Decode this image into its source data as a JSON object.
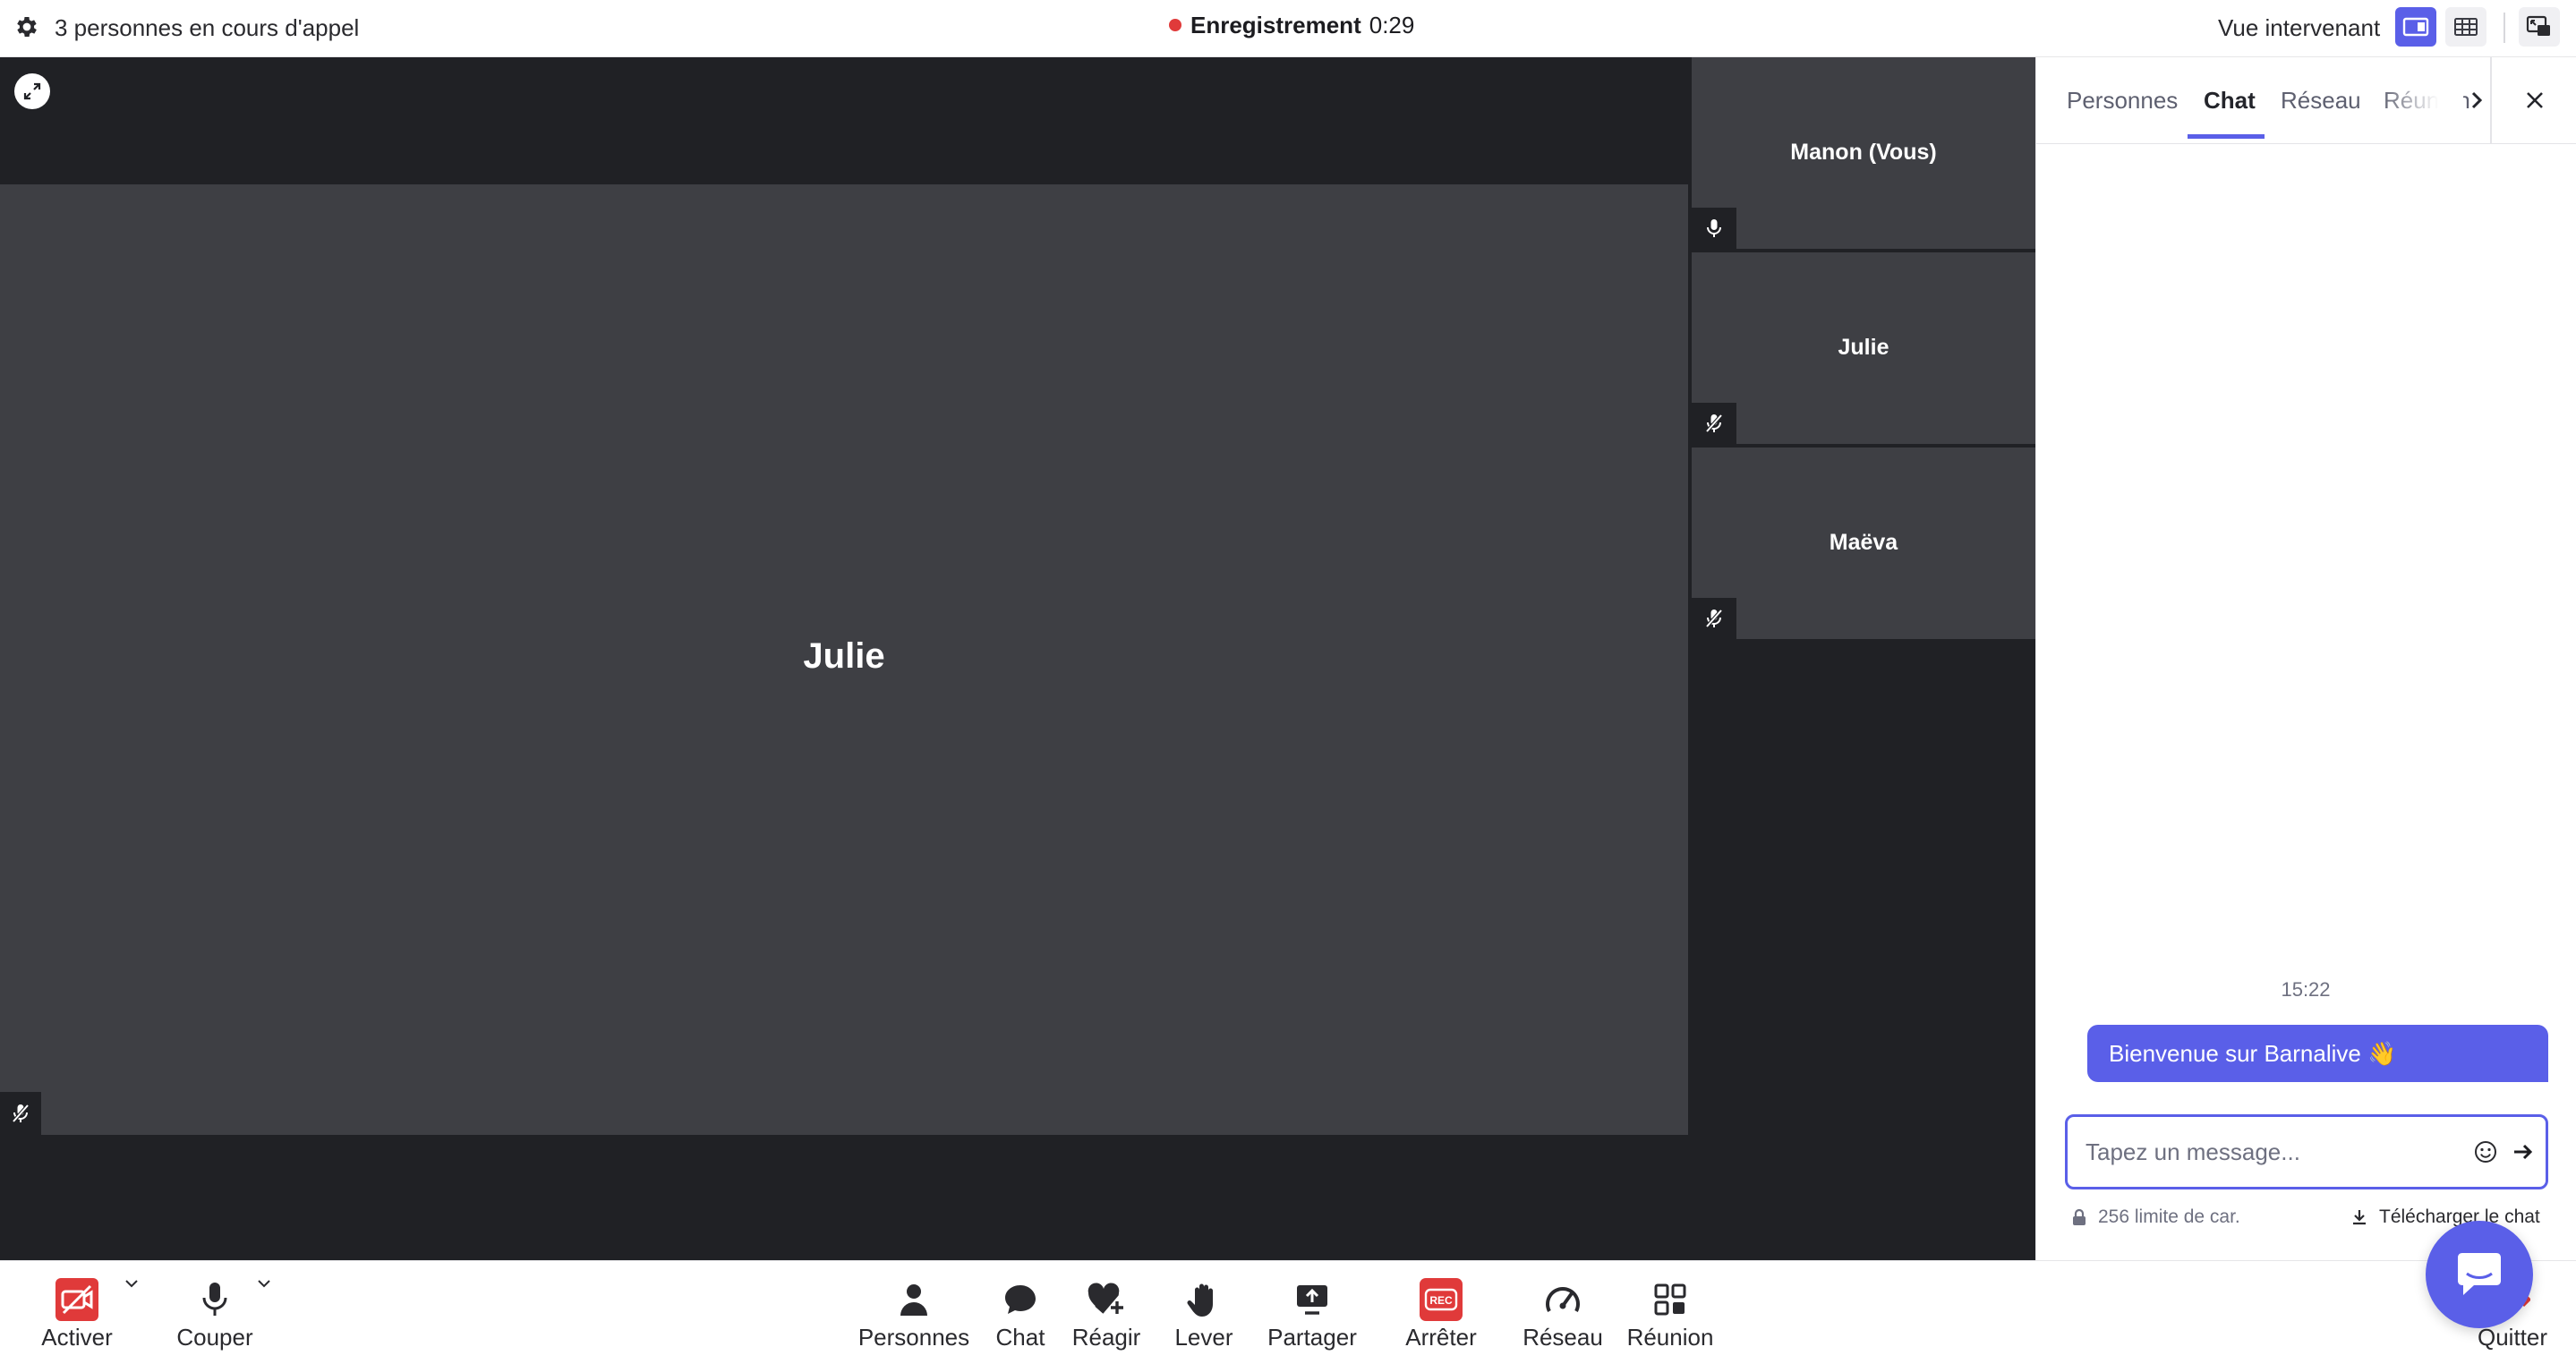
{
  "topbar": {
    "people_count": "3 personnes en cours d'appel",
    "recording_label": "Enregistrement",
    "recording_time": "0:29",
    "view_label": "Vue intervenant"
  },
  "stage": {
    "main_participant": "Julie",
    "participants": [
      {
        "name": "Manon (Vous)",
        "mic": "on"
      },
      {
        "name": "Julie",
        "mic": "muted"
      },
      {
        "name": "Maëva",
        "mic": "muted"
      }
    ]
  },
  "panel": {
    "tabs": [
      "Personnes",
      "Chat",
      "Réseau",
      "Réunion"
    ],
    "active_tab": "Chat",
    "chat": {
      "time": "15:22",
      "message": "Bienvenue sur Barnalive 👋",
      "input_placeholder": "Tapez un message...",
      "char_limit": "256 limite de car.",
      "download_label": "Télécharger le chat"
    }
  },
  "toolbar": {
    "camera_label": "Activer",
    "mic_label": "Couper",
    "people_label": "Personnes",
    "chat_label": "Chat",
    "react_label": "Réagir",
    "raise_label": "Lever",
    "share_label": "Partager",
    "stop_rec_label": "Arrêter",
    "rec_badge": "REC",
    "network_label": "Réseau",
    "meeting_label": "Réunion",
    "quit_label": "Quitter"
  },
  "colors": {
    "accent": "#5a5fe8",
    "recording": "#e03a3a",
    "stage_bg": "#202125",
    "tile_bg": "#3e3f44"
  }
}
